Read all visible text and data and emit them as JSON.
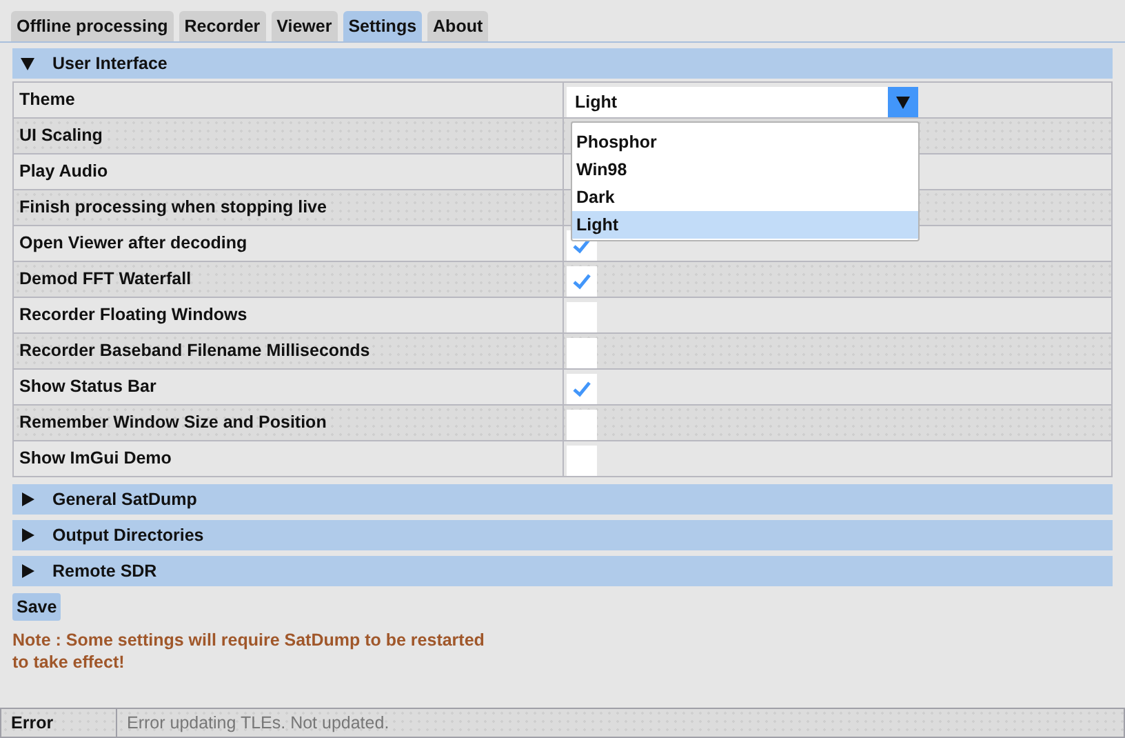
{
  "tabs": [
    {
      "label": "Offline processing",
      "selected": false
    },
    {
      "label": "Recorder",
      "selected": false
    },
    {
      "label": "Viewer",
      "selected": false
    },
    {
      "label": "Settings",
      "selected": true
    },
    {
      "label": "About",
      "selected": false
    }
  ],
  "sections": [
    {
      "title": "User Interface",
      "expanded": true,
      "rows": [
        {
          "label": "Theme",
          "kind": "combo",
          "value": "Light",
          "open": true,
          "options": [
            {
              "label": "Phosphor",
              "selected": false
            },
            {
              "label": "Win98",
              "selected": false
            },
            {
              "label": "Dark",
              "selected": false
            },
            {
              "label": "Light",
              "selected": true
            }
          ]
        },
        {
          "label": "UI Scaling",
          "kind": "covered"
        },
        {
          "label": "Play Audio",
          "kind": "covered"
        },
        {
          "label": "Finish processing when stopping live",
          "kind": "covered"
        },
        {
          "label": "Open Viewer after decoding",
          "kind": "checkbox",
          "checked": true
        },
        {
          "label": "Demod FFT Waterfall",
          "kind": "checkbox",
          "checked": true
        },
        {
          "label": "Recorder Floating Windows",
          "kind": "checkbox",
          "checked": false
        },
        {
          "label": "Recorder Baseband Filename Milliseconds",
          "kind": "checkbox",
          "checked": false
        },
        {
          "label": "Show Status Bar",
          "kind": "checkbox",
          "checked": true
        },
        {
          "label": "Remember Window Size and Position",
          "kind": "checkbox",
          "checked": false
        },
        {
          "label": "Show ImGui Demo",
          "kind": "checkbox",
          "checked": false
        }
      ]
    },
    {
      "title": "General SatDump",
      "expanded": false
    },
    {
      "title": "Output Directories",
      "expanded": false
    },
    {
      "title": "Remote SDR",
      "expanded": false
    }
  ],
  "save_button": "Save",
  "note": "Note : Some settings will require SatDump to be restarted to take effect!",
  "status_bar": {
    "level": "Error",
    "message": "Error updating TLEs. Not updated."
  }
}
